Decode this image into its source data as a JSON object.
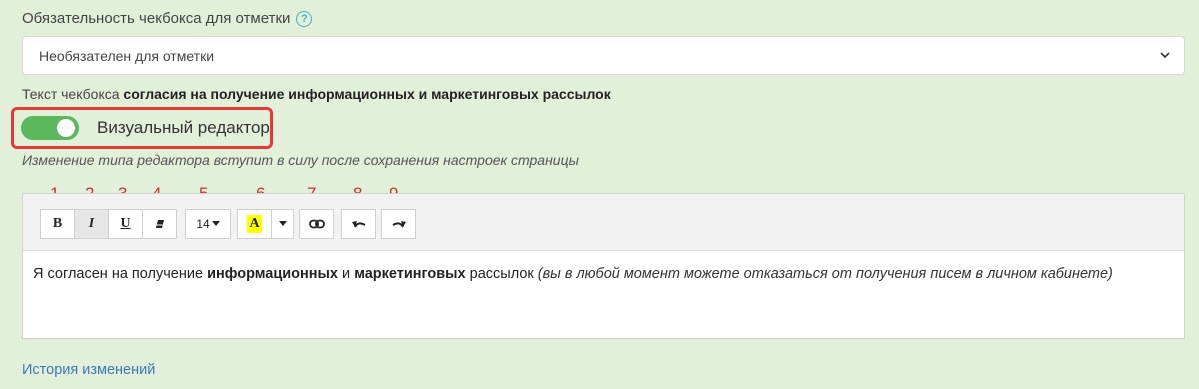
{
  "checkbox_required": {
    "label": "Обязательность чекбокса для отметки",
    "help_icon": "?",
    "selected": "Необязателен для отметки"
  },
  "checkbox_text": {
    "label_prefix": "Текст чекбокса ",
    "label_bold": "согласия на получение информационных и маркетинговых рассылок"
  },
  "visual_editor": {
    "label": "Визуальный редактор",
    "enabled": true,
    "note": "Изменение типа редактора вступит в силу после сохранения настроек страницы"
  },
  "annotations": [
    "1.",
    "2.",
    "3.",
    "4.",
    "5.",
    "6.",
    "7.",
    "8.",
    "9."
  ],
  "toolbar": {
    "bold": "B",
    "italic": "I",
    "underline": "U",
    "font_size": "14",
    "highlight": "A"
  },
  "content": {
    "p1": "Я согласен на получение ",
    "b1": "информационных",
    "p2": " и ",
    "b2": "маркетинговых",
    "p3": " рассылок ",
    "i1": "(вы в любой момент можете отказаться от получения писем в личном кабинете)"
  },
  "history_link": "История изменений",
  "colors": {
    "background": "#e2f0d9",
    "toggle_on": "#5cb85c",
    "highlight_border": "#e53935",
    "annotation": "#d32f2f",
    "link": "#3a78b9",
    "highlight_fill": "#ffff00"
  }
}
